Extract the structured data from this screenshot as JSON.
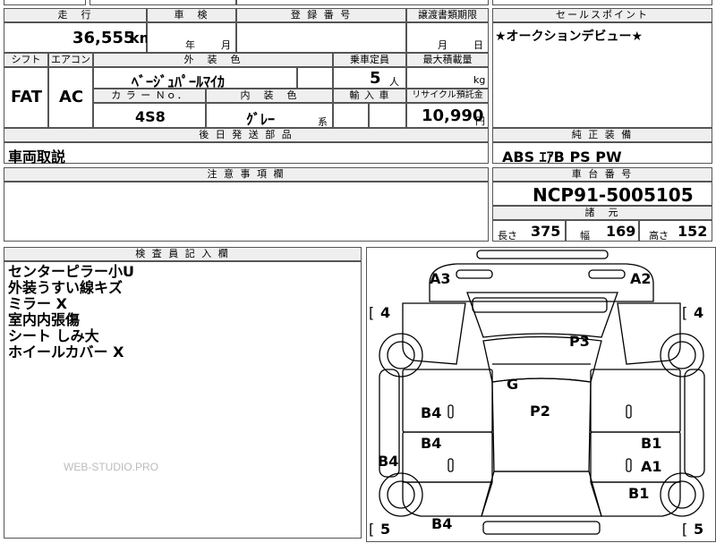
{
  "top_strip": {
    "partial_text": "昌修歴"
  },
  "mileage": {
    "header": "走　行",
    "value": "36,555",
    "unit": "km"
  },
  "shaken": {
    "header": "車　検",
    "year_unit": "年",
    "month_unit": "月"
  },
  "registration": {
    "header": "登 録 番 号"
  },
  "transfer_deadline": {
    "header": "譲渡書類期限",
    "month_unit": "月",
    "day_unit": "日"
  },
  "sales_point": {
    "header": "セールスポイント",
    "text": "★オークションデビュー★"
  },
  "shift": {
    "header": "シフト",
    "value": "FAT"
  },
  "aircon": {
    "header": "エアコン",
    "value": "AC"
  },
  "exterior_color": {
    "header": "外　装　色",
    "value": "ﾍﾞｰｼﾞｭﾊﾟｰﾙﾏｲｶ"
  },
  "capacity": {
    "header": "乗車定員",
    "value": "5",
    "unit": "人"
  },
  "max_load": {
    "header": "最大積載量",
    "unit": "kg"
  },
  "color_no": {
    "header": "カ ラ ー Ｎｏ．",
    "value": "4S8"
  },
  "interior_color": {
    "header": "内　装　色",
    "value": "ｸﾞﾚｰ",
    "suffix": "系"
  },
  "import": {
    "header": "輸 入 車"
  },
  "recycle": {
    "header": "リサイクル預託金",
    "value": "10,990",
    "unit": "円"
  },
  "later_parts": {
    "header": "後 日 発 送 部 品",
    "value": "車両取説"
  },
  "equipment": {
    "header": "純 正 装 備",
    "value": "ABS  ｴｱB  PS  PW"
  },
  "caution": {
    "header": "注 意 事 項 欄"
  },
  "chassis": {
    "header": "車 台 番 号",
    "value": "NCP91-5005105"
  },
  "specs": {
    "header": "諸　元",
    "length_label": "長さ",
    "length": "375",
    "width_label": "幅",
    "width": "169",
    "height_label": "高さ",
    "height": "152"
  },
  "inspector": {
    "header": "検 査 員 記 入 欄",
    "notes": [
      "センターピラー小U",
      "外装うすい線キズ",
      "ミラー X",
      "室内内張傷",
      "シート しみ大",
      "ホイールカバー X"
    ],
    "watermark": "WEB-STUDIO.PRO"
  },
  "diagram": {
    "labels": {
      "a3": "A3",
      "a2": "A2",
      "p3": "P3",
      "g": "G",
      "p2": "P2",
      "b4_left_top": "B4",
      "b4_left_mid": "B4",
      "b4_side": "B4",
      "b4_bottom": "B4",
      "b1_right_top": "B1",
      "a1": "A1",
      "b1_right_bottom": "B1",
      "tire_fl": "4",
      "tire_fr": "4",
      "tire_rl": "5",
      "tire_rr": "5"
    },
    "bracket_open": "[",
    "tire_marker_small": "0"
  }
}
